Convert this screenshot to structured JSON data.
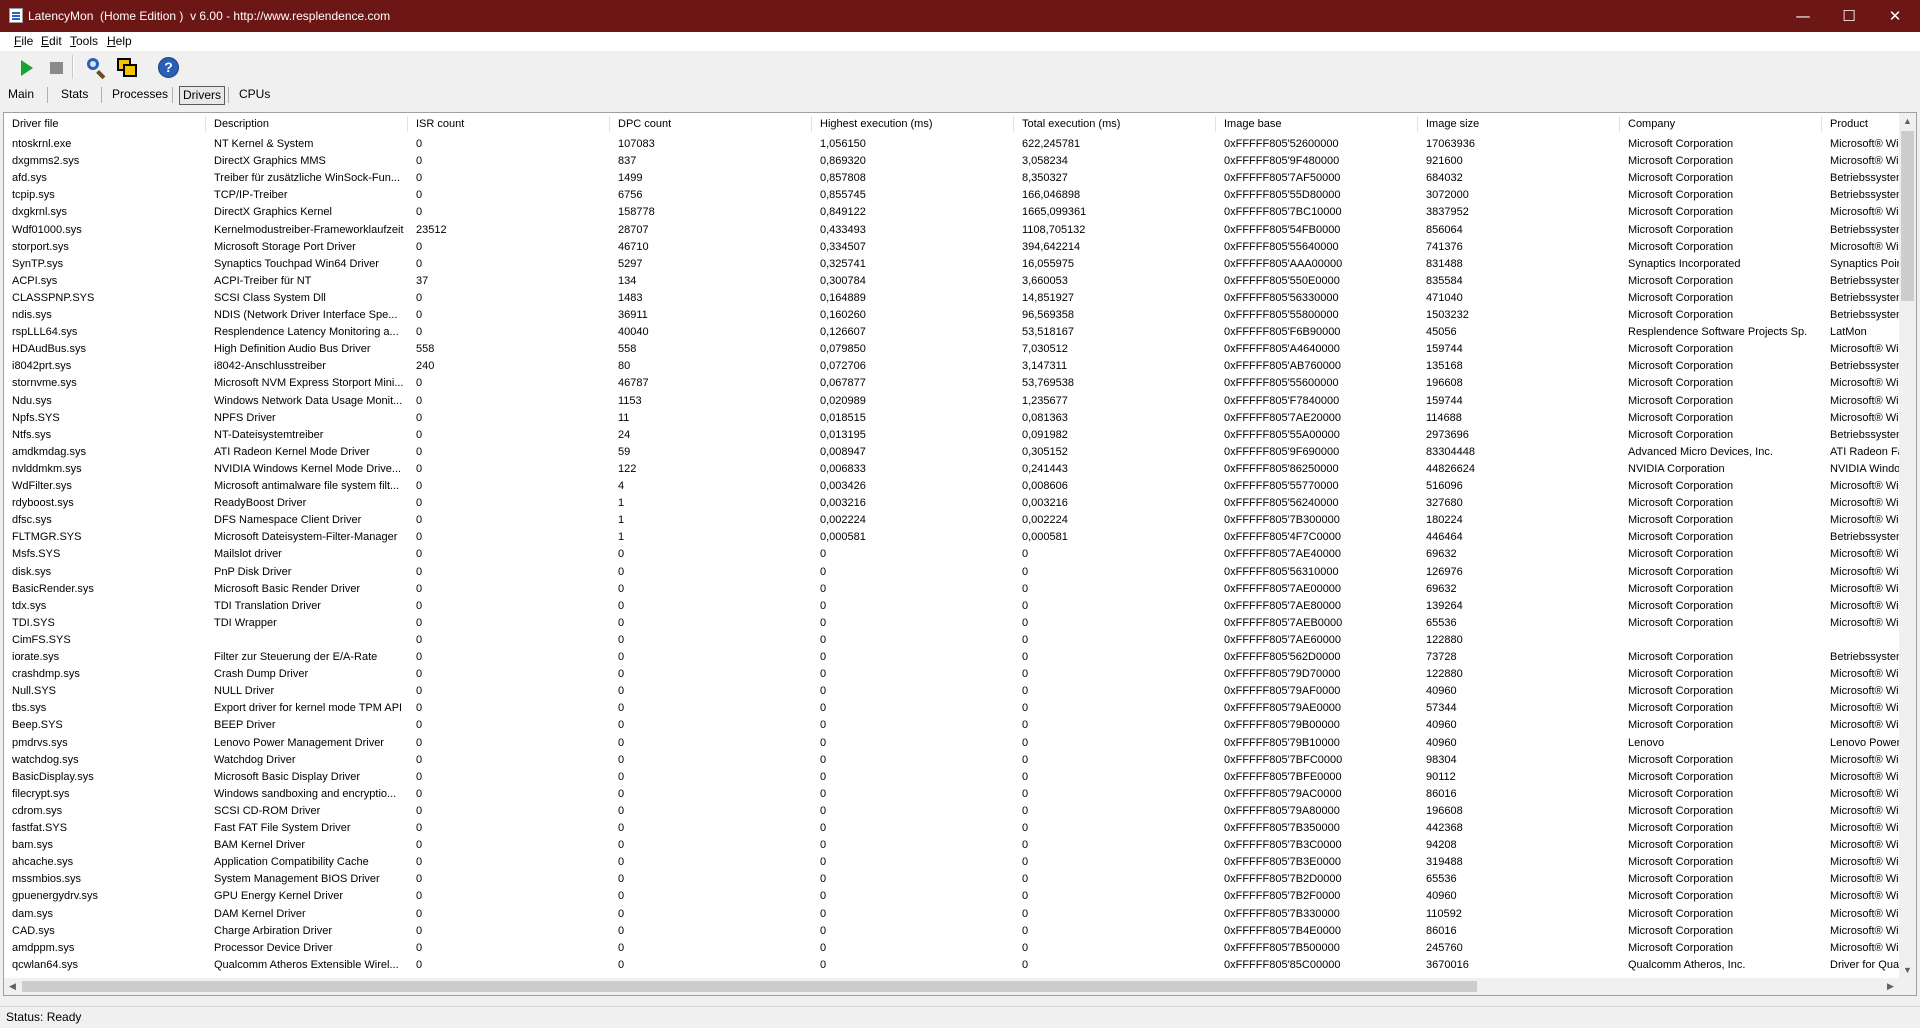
{
  "window": {
    "title": "LatencyMon  (Home Edition )  v 6.00 - http://www.resplendence.com",
    "controls": {
      "minimize": "—",
      "maximize": "☐",
      "close": "✕"
    }
  },
  "menu": [
    {
      "mnemonic": "F",
      "rest": "ile"
    },
    {
      "mnemonic": "E",
      "rest": "dit"
    },
    {
      "mnemonic": "T",
      "rest": "ools"
    },
    {
      "mnemonic": "H",
      "rest": "elp"
    }
  ],
  "toolbar": {
    "buttons": [
      "start-icon",
      "stop-icon",
      "analyze-icon",
      "windows-icon",
      "help-icon"
    ],
    "help_glyph": "?"
  },
  "tabs": [
    {
      "label": "Main",
      "active": false
    },
    {
      "label": "Stats",
      "active": false
    },
    {
      "label": "Processes",
      "active": false
    },
    {
      "label": "Drivers",
      "active": true
    },
    {
      "label": "CPUs",
      "active": false
    }
  ],
  "table": {
    "columns": [
      "Driver file",
      "Description",
      "ISR count",
      "DPC count",
      "Highest execution (ms)",
      "Total execution (ms)",
      "Image base",
      "Image size",
      "Company",
      "Product"
    ],
    "rows": [
      [
        "ntoskrnl.exe",
        "NT Kernel & System",
        "0",
        "107083",
        "1,056150",
        "622,245781",
        "0xFFFFF805'52600000",
        "17063936",
        "Microsoft Corporation",
        "Microsoft® Wi"
      ],
      [
        "dxgmms2.sys",
        "DirectX Graphics MMS",
        "0",
        "837",
        "0,869320",
        "3,058234",
        "0xFFFFF805'9F480000",
        "921600",
        "Microsoft Corporation",
        "Microsoft® Wi"
      ],
      [
        "afd.sys",
        "Treiber für zusätzliche WinSock-Fun...",
        "0",
        "1499",
        "0,857808",
        "8,350327",
        "0xFFFFF805'7AF50000",
        "684032",
        "Microsoft Corporation",
        "Betriebssysten"
      ],
      [
        "tcpip.sys",
        "TCP/IP-Treiber",
        "0",
        "6756",
        "0,855745",
        "166,046898",
        "0xFFFFF805'55D80000",
        "3072000",
        "Microsoft Corporation",
        "Betriebssysten"
      ],
      [
        "dxgkrnl.sys",
        "DirectX Graphics Kernel",
        "0",
        "158778",
        "0,849122",
        "1665,099361",
        "0xFFFFF805'7BC10000",
        "3837952",
        "Microsoft Corporation",
        "Microsoft® Wi"
      ],
      [
        "Wdf01000.sys",
        "Kernelmodustreiber-Frameworklaufzeit",
        "23512",
        "28707",
        "0,433493",
        "1108,705132",
        "0xFFFFF805'54FB0000",
        "856064",
        "Microsoft Corporation",
        "Betriebssysten"
      ],
      [
        "storport.sys",
        "Microsoft Storage Port Driver",
        "0",
        "46710",
        "0,334507",
        "394,642214",
        "0xFFFFF805'55640000",
        "741376",
        "Microsoft Corporation",
        "Microsoft® Wi"
      ],
      [
        "SynTP.sys",
        "Synaptics Touchpad Win64 Driver",
        "0",
        "5297",
        "0,325741",
        "16,055975",
        "0xFFFFF805'AAA00000",
        "831488",
        "Synaptics Incorporated",
        "Synaptics Poin"
      ],
      [
        "ACPI.sys",
        "ACPI-Treiber für NT",
        "37",
        "134",
        "0,300784",
        "3,660053",
        "0xFFFFF805'550E0000",
        "835584",
        "Microsoft Corporation",
        "Betriebssysten"
      ],
      [
        "CLASSPNP.SYS",
        "SCSI Class System Dll",
        "0",
        "1483",
        "0,164889",
        "14,851927",
        "0xFFFFF805'56330000",
        "471040",
        "Microsoft Corporation",
        "Betriebssysten"
      ],
      [
        "ndis.sys",
        "NDIS (Network Driver Interface Spe...",
        "0",
        "36911",
        "0,160260",
        "96,569358",
        "0xFFFFF805'55800000",
        "1503232",
        "Microsoft Corporation",
        "Betriebssysten"
      ],
      [
        "rspLLL64.sys",
        "Resplendence Latency Monitoring a...",
        "0",
        "40040",
        "0,126607",
        "53,518167",
        "0xFFFFF805'F6B90000",
        "45056",
        "Resplendence Software Projects Sp.",
        "LatMon"
      ],
      [
        "HDAudBus.sys",
        "High Definition Audio Bus Driver",
        "558",
        "558",
        "0,079850",
        "7,030512",
        "0xFFFFF805'A4640000",
        "159744",
        "Microsoft Corporation",
        "Microsoft® Wi"
      ],
      [
        "i8042prt.sys",
        "i8042-Anschlusstreiber",
        "240",
        "80",
        "0,072706",
        "3,147311",
        "0xFFFFF805'AB760000",
        "135168",
        "Microsoft Corporation",
        "Betriebssysten"
      ],
      [
        "stornvme.sys",
        "Microsoft NVM Express Storport Mini...",
        "0",
        "46787",
        "0,067877",
        "53,769538",
        "0xFFFFF805'55600000",
        "196608",
        "Microsoft Corporation",
        "Microsoft® Wi"
      ],
      [
        "Ndu.sys",
        "Windows Network Data Usage Monit...",
        "0",
        "1153",
        "0,020989",
        "1,235677",
        "0xFFFFF805'F7840000",
        "159744",
        "Microsoft Corporation",
        "Microsoft® Wi"
      ],
      [
        "Npfs.SYS",
        "NPFS Driver",
        "0",
        "11",
        "0,018515",
        "0,081363",
        "0xFFFFF805'7AE20000",
        "114688",
        "Microsoft Corporation",
        "Microsoft® Wi"
      ],
      [
        "Ntfs.sys",
        "NT-Dateisystemtreiber",
        "0",
        "24",
        "0,013195",
        "0,091982",
        "0xFFFFF805'55A00000",
        "2973696",
        "Microsoft Corporation",
        "Betriebssysten"
      ],
      [
        "amdkmdag.sys",
        "ATI Radeon Kernel Mode Driver",
        "0",
        "59",
        "0,008947",
        "0,305152",
        "0xFFFFF805'9F690000",
        "83304448",
        "Advanced Micro Devices, Inc.",
        "ATI Radeon Fa"
      ],
      [
        "nvlddmkm.sys",
        "NVIDIA Windows Kernel Mode Drive...",
        "0",
        "122",
        "0,006833",
        "0,241443",
        "0xFFFFF805'86250000",
        "44826624",
        "NVIDIA Corporation",
        "NVIDIA Windo"
      ],
      [
        "WdFilter.sys",
        "Microsoft antimalware file system filt...",
        "0",
        "4",
        "0,003426",
        "0,008606",
        "0xFFFFF805'55770000",
        "516096",
        "Microsoft Corporation",
        "Microsoft® Wi"
      ],
      [
        "rdyboost.sys",
        "ReadyBoost Driver",
        "0",
        "1",
        "0,003216",
        "0,003216",
        "0xFFFFF805'56240000",
        "327680",
        "Microsoft Corporation",
        "Microsoft® Wi"
      ],
      [
        "dfsc.sys",
        "DFS Namespace Client Driver",
        "0",
        "1",
        "0,002224",
        "0,002224",
        "0xFFFFF805'7B300000",
        "180224",
        "Microsoft Corporation",
        "Microsoft® Wi"
      ],
      [
        "FLTMGR.SYS",
        "Microsoft Dateisystem-Filter-Manager",
        "0",
        "1",
        "0,000581",
        "0,000581",
        "0xFFFFF805'4F7C0000",
        "446464",
        "Microsoft Corporation",
        "Betriebssysten"
      ],
      [
        "Msfs.SYS",
        "Mailslot driver",
        "0",
        "0",
        "0",
        "0",
        "0xFFFFF805'7AE40000",
        "69632",
        "Microsoft Corporation",
        "Microsoft® Wi"
      ],
      [
        "disk.sys",
        "PnP Disk Driver",
        "0",
        "0",
        "0",
        "0",
        "0xFFFFF805'56310000",
        "126976",
        "Microsoft Corporation",
        "Microsoft® Wi"
      ],
      [
        "BasicRender.sys",
        "Microsoft Basic Render Driver",
        "0",
        "0",
        "0",
        "0",
        "0xFFFFF805'7AE00000",
        "69632",
        "Microsoft Corporation",
        "Microsoft® Wi"
      ],
      [
        "tdx.sys",
        "TDI Translation Driver",
        "0",
        "0",
        "0",
        "0",
        "0xFFFFF805'7AE80000",
        "139264",
        "Microsoft Corporation",
        "Microsoft® Wi"
      ],
      [
        "TDI.SYS",
        "TDI Wrapper",
        "0",
        "0",
        "0",
        "0",
        "0xFFFFF805'7AEB0000",
        "65536",
        "Microsoft Corporation",
        "Microsoft® Wi"
      ],
      [
        "CimFS.SYS",
        "",
        "0",
        "0",
        "0",
        "0",
        "0xFFFFF805'7AE60000",
        "122880",
        "",
        ""
      ],
      [
        "iorate.sys",
        "Filter zur Steuerung der E/A-Rate",
        "0",
        "0",
        "0",
        "0",
        "0xFFFFF805'562D0000",
        "73728",
        "Microsoft Corporation",
        "Betriebssysten"
      ],
      [
        "crashdmp.sys",
        "Crash Dump Driver",
        "0",
        "0",
        "0",
        "0",
        "0xFFFFF805'79D70000",
        "122880",
        "Microsoft Corporation",
        "Microsoft® Wi"
      ],
      [
        "Null.SYS",
        "NULL Driver",
        "0",
        "0",
        "0",
        "0",
        "0xFFFFF805'79AF0000",
        "40960",
        "Microsoft Corporation",
        "Microsoft® Wi"
      ],
      [
        "tbs.sys",
        "Export driver for kernel mode TPM API",
        "0",
        "0",
        "0",
        "0",
        "0xFFFFF805'79AE0000",
        "57344",
        "Microsoft Corporation",
        "Microsoft® Wi"
      ],
      [
        "Beep.SYS",
        "BEEP Driver",
        "0",
        "0",
        "0",
        "0",
        "0xFFFFF805'79B00000",
        "40960",
        "Microsoft Corporation",
        "Microsoft® Wi"
      ],
      [
        "pmdrvs.sys",
        "Lenovo Power Management Driver",
        "0",
        "0",
        "0",
        "0",
        "0xFFFFF805'79B10000",
        "40960",
        "Lenovo",
        "Lenovo Power"
      ],
      [
        "watchdog.sys",
        "Watchdog Driver",
        "0",
        "0",
        "0",
        "0",
        "0xFFFFF805'7BFC0000",
        "98304",
        "Microsoft Corporation",
        "Microsoft® Wi"
      ],
      [
        "BasicDisplay.sys",
        "Microsoft Basic Display Driver",
        "0",
        "0",
        "0",
        "0",
        "0xFFFFF805'7BFE0000",
        "90112",
        "Microsoft Corporation",
        "Microsoft® Wi"
      ],
      [
        "filecrypt.sys",
        "Windows sandboxing and encryptio...",
        "0",
        "0",
        "0",
        "0",
        "0xFFFFF805'79AC0000",
        "86016",
        "Microsoft Corporation",
        "Microsoft® Wi"
      ],
      [
        "cdrom.sys",
        "SCSI CD-ROM Driver",
        "0",
        "0",
        "0",
        "0",
        "0xFFFFF805'79A80000",
        "196608",
        "Microsoft Corporation",
        "Microsoft® Wi"
      ],
      [
        "fastfat.SYS",
        "Fast FAT File System Driver",
        "0",
        "0",
        "0",
        "0",
        "0xFFFFF805'7B350000",
        "442368",
        "Microsoft Corporation",
        "Microsoft® Wi"
      ],
      [
        "bam.sys",
        "BAM Kernel Driver",
        "0",
        "0",
        "0",
        "0",
        "0xFFFFF805'7B3C0000",
        "94208",
        "Microsoft Corporation",
        "Microsoft® Wi"
      ],
      [
        "ahcache.sys",
        "Application Compatibility Cache",
        "0",
        "0",
        "0",
        "0",
        "0xFFFFF805'7B3E0000",
        "319488",
        "Microsoft Corporation",
        "Microsoft® Wi"
      ],
      [
        "mssmbios.sys",
        "System Management BIOS Driver",
        "0",
        "0",
        "0",
        "0",
        "0xFFFFF805'7B2D0000",
        "65536",
        "Microsoft Corporation",
        "Microsoft® Wi"
      ],
      [
        "gpuenergydrv.sys",
        "GPU Energy Kernel Driver",
        "0",
        "0",
        "0",
        "0",
        "0xFFFFF805'7B2F0000",
        "40960",
        "Microsoft Corporation",
        "Microsoft® Wi"
      ],
      [
        "dam.sys",
        "DAM Kernel Driver",
        "0",
        "0",
        "0",
        "0",
        "0xFFFFF805'7B330000",
        "110592",
        "Microsoft Corporation",
        "Microsoft® Wi"
      ],
      [
        "CAD.sys",
        "Charge Arbiration Driver",
        "0",
        "0",
        "0",
        "0",
        "0xFFFFF805'7B4E0000",
        "86016",
        "Microsoft Corporation",
        "Microsoft® Wi"
      ],
      [
        "amdppm.sys",
        "Processor Device Driver",
        "0",
        "0",
        "0",
        "0",
        "0xFFFFF805'7B500000",
        "245760",
        "Microsoft Corporation",
        "Microsoft® Wi"
      ],
      [
        "qcwlan64.sys",
        "Qualcomm Atheros Extensible Wirel...",
        "0",
        "0",
        "0",
        "0",
        "0xFFFFF805'85C00000",
        "3670016",
        "Qualcomm Atheros, Inc.",
        "Driver for Qua"
      ]
    ]
  },
  "status": "Status: Ready"
}
